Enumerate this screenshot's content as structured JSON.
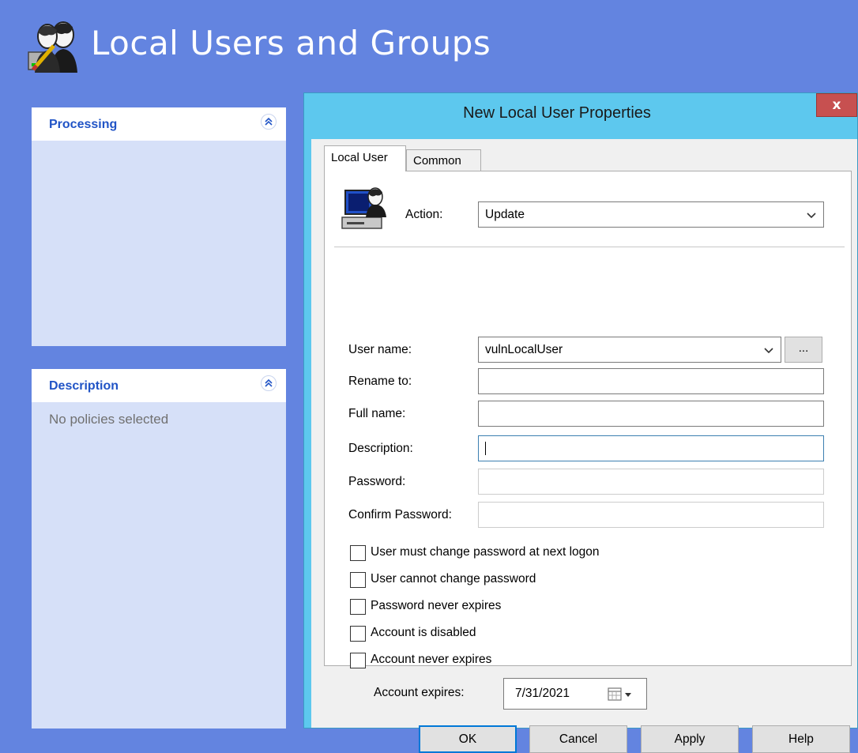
{
  "app": {
    "title": "Local Users and Groups",
    "icon": "users-groups-icon"
  },
  "panels": {
    "processing": {
      "title": "Processing",
      "body": ""
    },
    "description": {
      "title": "Description",
      "body": "No policies selected"
    }
  },
  "dialog": {
    "title": "New Local User Properties",
    "close_label": "x",
    "tabs": [
      {
        "label": "Local User",
        "active": true
      },
      {
        "label": "Common",
        "active": false
      }
    ],
    "action": {
      "label": "Action:",
      "value": "Update"
    },
    "fields": {
      "user_name": {
        "label": "User name:",
        "value": "vulnLocalUser"
      },
      "rename_to": {
        "label": "Rename to:",
        "value": ""
      },
      "full_name": {
        "label": "Full name:",
        "value": ""
      },
      "description": {
        "label": "Description:",
        "value": ""
      },
      "password": {
        "label": "Password:",
        "value": ""
      },
      "confirm_password": {
        "label": "Confirm Password:",
        "value": ""
      }
    },
    "browse_label": "...",
    "checkboxes": [
      {
        "label": "User must change password at next logon",
        "checked": false
      },
      {
        "label": "User cannot change password",
        "checked": false
      },
      {
        "label": "Password never expires",
        "checked": false
      },
      {
        "label": "Account is disabled",
        "checked": false
      },
      {
        "label": "Account never expires",
        "checked": false
      }
    ],
    "account_expires": {
      "label": "Account expires:",
      "value": "7/31/2021"
    },
    "buttons": {
      "ok": "OK",
      "cancel": "Cancel",
      "apply": "Apply",
      "help": "Help"
    }
  },
  "colors": {
    "background": "#6384e0",
    "panel_title": "#2154c6",
    "dialog_frame": "#5dc8ee",
    "close_button": "#c75050"
  }
}
